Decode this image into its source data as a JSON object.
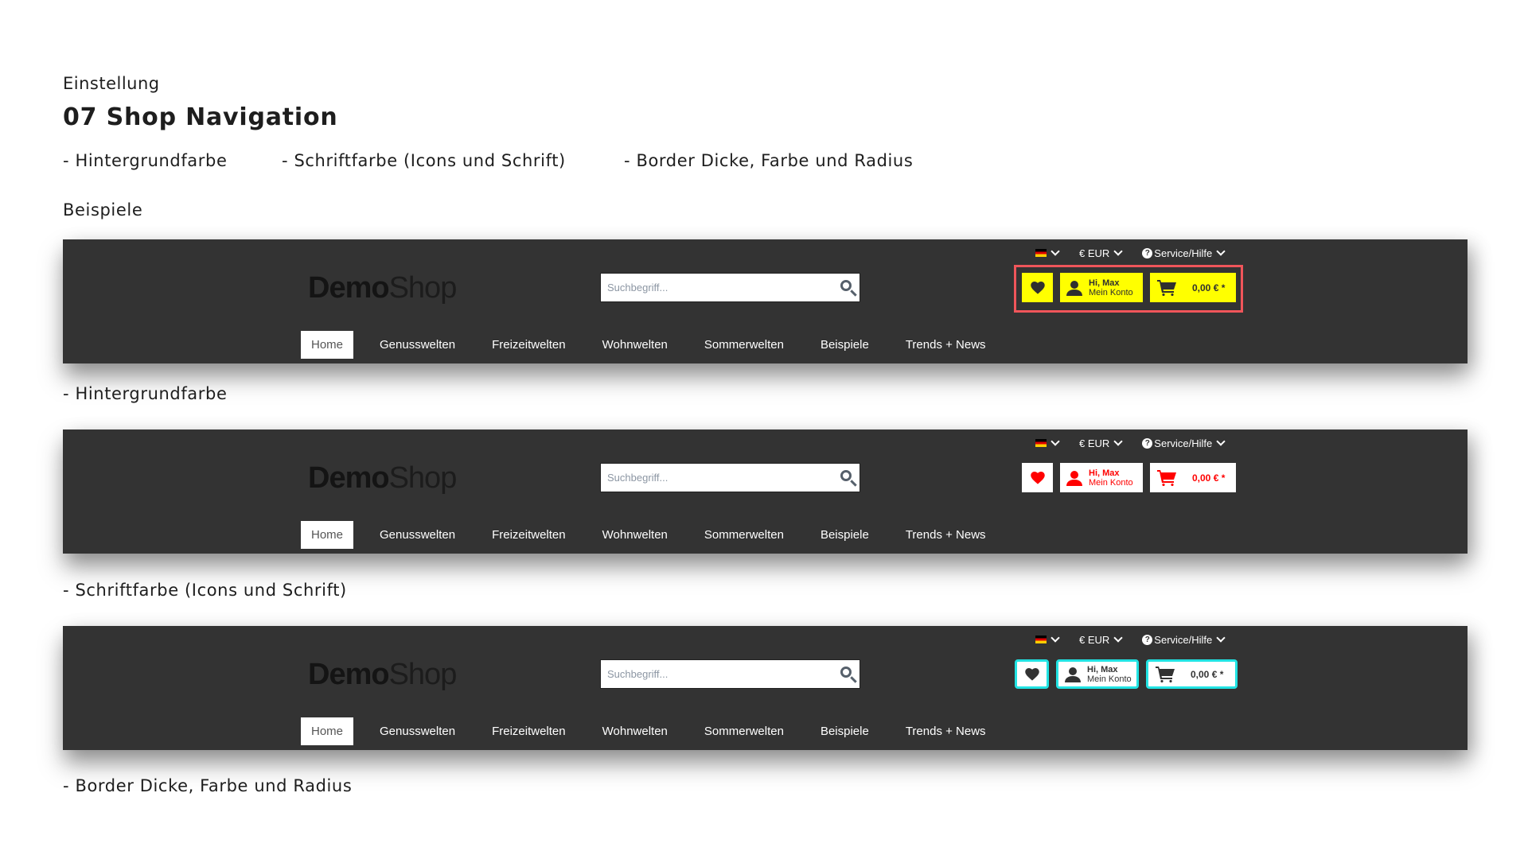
{
  "header": {
    "eyebrow": "Einstellung",
    "title": "07 Shop Navigation",
    "features": [
      "- Hintergrundfarbe",
      "- Schriftfarbe (Icons und Schrift)",
      "- Border Dicke, Farbe und Radius"
    ],
    "examples_label": "Beispiele"
  },
  "shop": {
    "logo_bold": "Demo",
    "logo_light": "Shop",
    "language_flag": "de-flag-icon",
    "currency": "€ EUR",
    "service": "Service/Hilfe",
    "search_placeholder": "Suchbegriff...",
    "account_greeting": "Hi, Max",
    "account_label": "Mein Konto",
    "cart_total": "0,00 € *",
    "menu": [
      "Home",
      "Genusswelten",
      "Freizeitwelten",
      "Wohnwelten",
      "Sommerwelten",
      "Beispiele",
      "Trends + News"
    ],
    "active_menu": "Home"
  },
  "examples": [
    {
      "caption": "- Hintergrundfarbe",
      "button_bg": "#ffff00",
      "button_fg": "#2f2f2f",
      "highlight_color": "#f0555a"
    },
    {
      "caption": "- Schriftfarbe (Icons und Schrift)",
      "button_bg": "#ffffff",
      "button_fg": "#ff0000"
    },
    {
      "caption": "- Border Dicke, Farbe und Radius",
      "button_bg": "#ffffff",
      "button_fg": "#333333",
      "border_color": "#22e3e3"
    }
  ],
  "colors": {
    "navbar_bg": "#333333",
    "page_bg": "#ffffff"
  }
}
